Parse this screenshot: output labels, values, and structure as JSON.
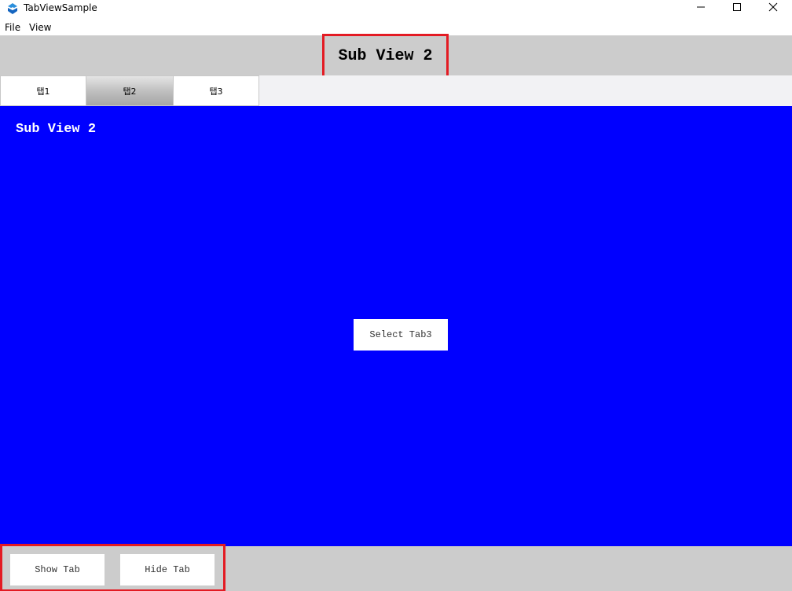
{
  "window": {
    "title": "TabViewSample",
    "icon": "app-logo-icon",
    "controls": [
      "minimize-icon",
      "maximize-icon",
      "close-icon"
    ]
  },
  "menu": {
    "items": [
      {
        "label": "File"
      },
      {
        "label": "View"
      }
    ]
  },
  "header": {
    "title": "Sub View 2"
  },
  "tabs": [
    {
      "label": "탭1",
      "selected": false
    },
    {
      "label": "탭2",
      "selected": true
    },
    {
      "label": "탭3",
      "selected": false
    }
  ],
  "content": {
    "title": "Sub View 2",
    "background": "#0000ff",
    "select_button": "Select Tab3"
  },
  "footer": {
    "show_button": "Show Tab",
    "hide_button": "Hide Tab"
  },
  "colors": {
    "highlight": "#e31b23",
    "band": "#cccccc",
    "content": "#0000ff"
  }
}
